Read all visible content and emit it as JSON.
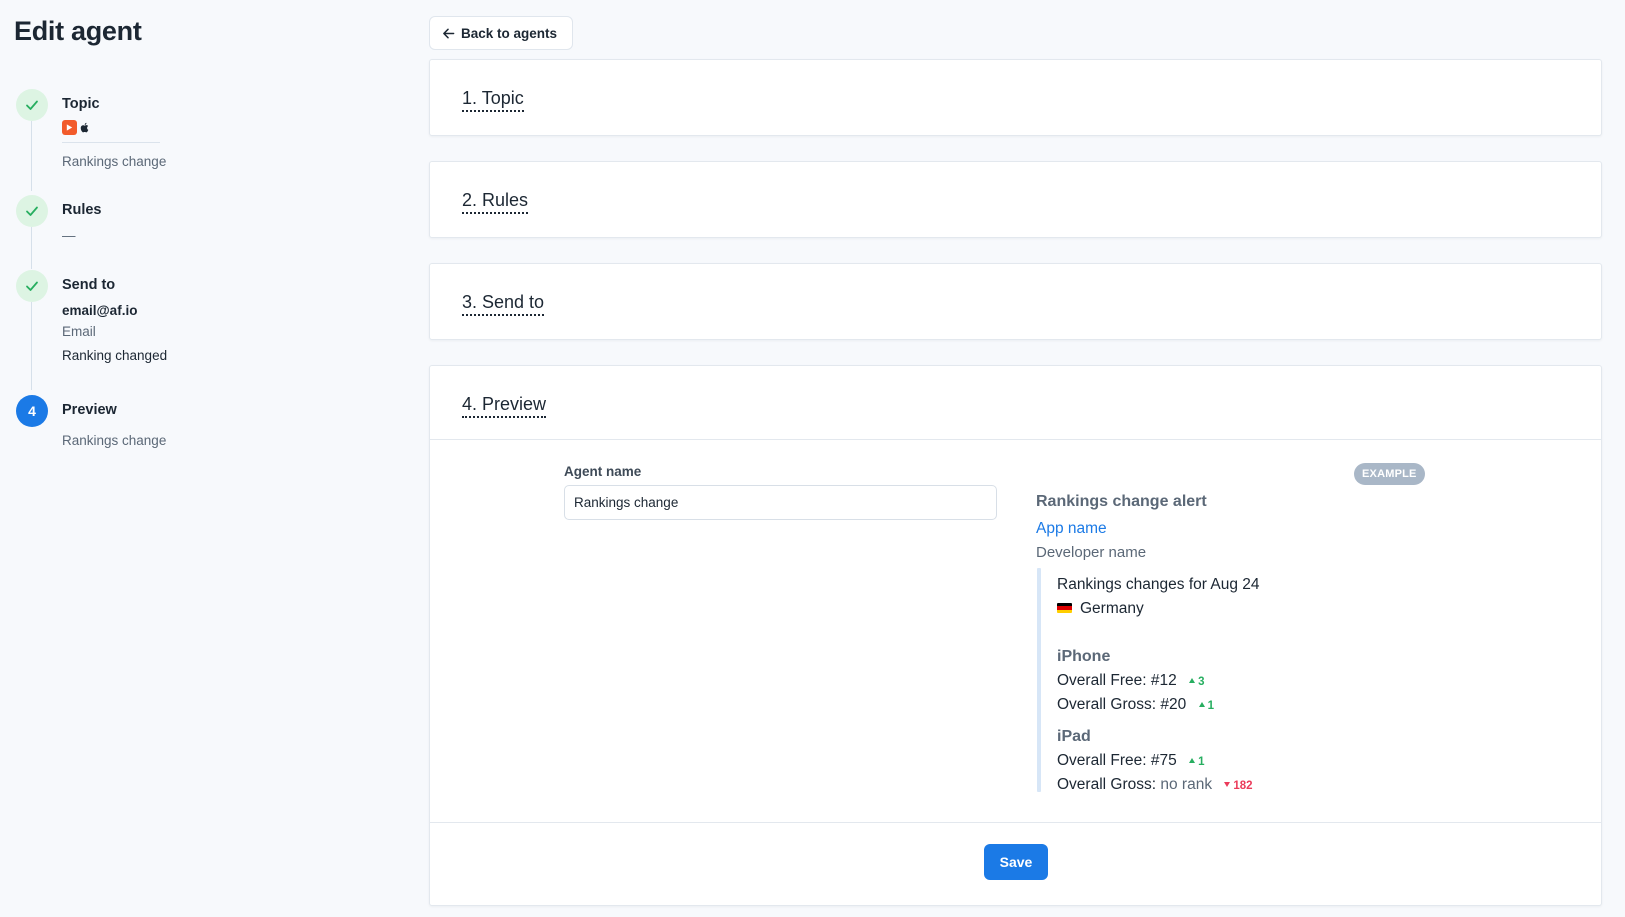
{
  "page": {
    "title": "Edit agent"
  },
  "steps": [
    {
      "title": "Topic",
      "subtitle": "Rankings change",
      "state": "done"
    },
    {
      "title": "Rules",
      "subtitle": "—",
      "state": "done"
    },
    {
      "title": "Send to",
      "recipient": "email@af.io",
      "channel": "Email",
      "event": "Ranking changed",
      "state": "done"
    },
    {
      "number": "4",
      "title": "Preview",
      "subtitle": "Rankings change",
      "state": "active"
    }
  ],
  "back_button": {
    "label": "Back to agents"
  },
  "sections": {
    "topic": {
      "heading": "1. Topic"
    },
    "rules": {
      "heading": "2. Rules"
    },
    "send_to": {
      "heading": "3. Send to"
    },
    "preview": {
      "heading": "4. Preview"
    }
  },
  "form": {
    "agent_name_label": "Agent name",
    "agent_name_value": "Rankings change",
    "save_label": "Save"
  },
  "preview": {
    "badge": "EXAMPLE",
    "alert_title": "Rankings change alert",
    "app_name": "App name",
    "developer_name": "Developer name",
    "date_line": "Rankings changes for Aug 24",
    "country": "Germany",
    "devices": [
      {
        "name": "iPhone",
        "rows": [
          {
            "label": "Overall Free:",
            "value": "#12",
            "change": "3",
            "direction": "up"
          },
          {
            "label": "Overall Gross:",
            "value": "#20",
            "change": "1",
            "direction": "up"
          }
        ]
      },
      {
        "name": "iPad",
        "rows": [
          {
            "label": "Overall Free:",
            "value": "#75",
            "change": "1",
            "direction": "up"
          },
          {
            "label": "Overall Gross:",
            "value": "no rank",
            "change": "182",
            "direction": "down"
          }
        ]
      }
    ]
  },
  "colors": {
    "accent": "#1b7ae6",
    "success": "#27ae60",
    "danger": "#eb3b5a",
    "badge": "#a9b7c7"
  },
  "icons": {
    "step_done": "check-icon",
    "back": "arrow-left-icon",
    "app": "app-store-logo-icon",
    "platform": "apple-icon",
    "country": "germany-flag-icon",
    "rank_up": "triangle-up-icon",
    "rank_down": "triangle-down-icon"
  }
}
